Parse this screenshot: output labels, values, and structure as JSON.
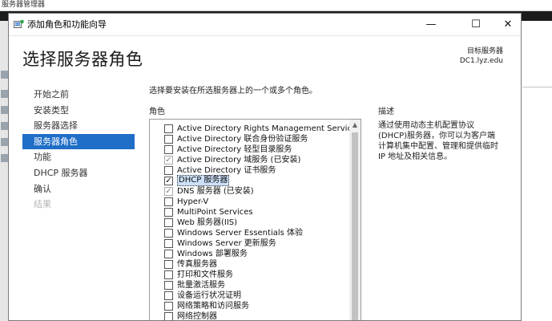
{
  "background_window": {
    "title": "服务器管理器"
  },
  "dialog": {
    "title": "添加角色和功能向导",
    "controls": {
      "minimize": "—",
      "maximize": "☐",
      "close": "✕"
    }
  },
  "header": {
    "page_title": "选择服务器角色",
    "destination_label": "目标服务器",
    "destination_value": "DC1.lyz.edu"
  },
  "nav": {
    "items": [
      {
        "label": "开始之前",
        "state": "normal"
      },
      {
        "label": "安装类型",
        "state": "normal"
      },
      {
        "label": "服务器选择",
        "state": "normal"
      },
      {
        "label": "服务器角色",
        "state": "active"
      },
      {
        "label": "功能",
        "state": "normal"
      },
      {
        "label": "DHCP 服务器",
        "state": "normal"
      },
      {
        "label": "确认",
        "state": "normal"
      },
      {
        "label": "结果",
        "state": "disabled"
      }
    ]
  },
  "main": {
    "instruction": "选择要安装在所选服务器上的一个或多个角色。",
    "roles_header": "角色",
    "description_header": "描述",
    "description_text": "通过使用动态主机配置协议(DHCP)服务器，你可以为客户端计算机集中配置、管理和提供临时 IP 地址及相关信息。",
    "roles": [
      {
        "label": "Active Directory Rights Management Services",
        "checked": false,
        "installed": false
      },
      {
        "label": "Active Directory 联合身份验证服务",
        "checked": false,
        "installed": false
      },
      {
        "label": "Active Directory 轻型目录服务",
        "checked": false,
        "installed": false
      },
      {
        "label": "Active Directory 域服务 (已安装)",
        "checked": true,
        "installed": true
      },
      {
        "label": "Active Directory 证书服务",
        "checked": false,
        "installed": false
      },
      {
        "label": "DHCP 服务器",
        "checked": true,
        "installed": false,
        "highlighted": true
      },
      {
        "label": "DNS 服务器 (已安装)",
        "checked": true,
        "installed": true
      },
      {
        "label": "Hyper-V",
        "checked": false,
        "installed": false
      },
      {
        "label": "MultiPoint Services",
        "checked": false,
        "installed": false
      },
      {
        "label": "Web 服务器(IIS)",
        "checked": false,
        "installed": false
      },
      {
        "label": "Windows Server Essentials 体验",
        "checked": false,
        "installed": false
      },
      {
        "label": "Windows Server 更新服务",
        "checked": false,
        "installed": false
      },
      {
        "label": "Windows 部署服务",
        "checked": false,
        "installed": false
      },
      {
        "label": "传真服务器",
        "checked": false,
        "installed": false
      },
      {
        "label": "打印和文件服务",
        "checked": false,
        "installed": false
      },
      {
        "label": "批量激活服务",
        "checked": false,
        "installed": false
      },
      {
        "label": "设备运行状况证明",
        "checked": false,
        "installed": false
      },
      {
        "label": "网络策略和访问服务",
        "checked": false,
        "installed": false
      },
      {
        "label": "网络控制器",
        "checked": false,
        "installed": false
      }
    ]
  },
  "colors": {
    "accent": "#1f6ec8",
    "highlight": "#cce0f7"
  }
}
